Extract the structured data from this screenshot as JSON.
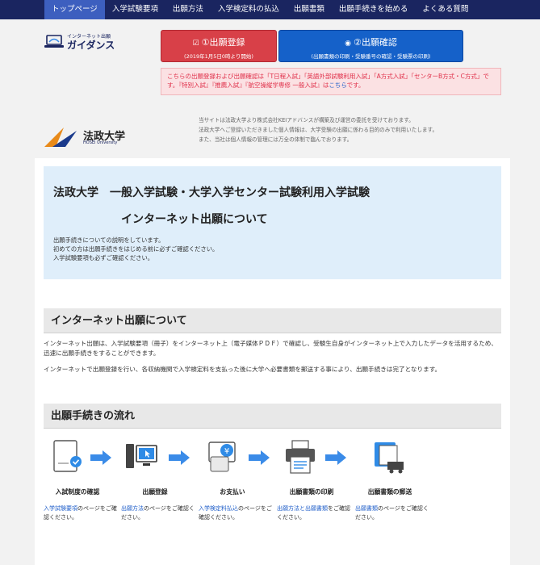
{
  "nav": {
    "items": [
      {
        "label": "トップページ"
      },
      {
        "label": "入学試験要項"
      },
      {
        "label": "出願方法"
      },
      {
        "label": "入学検定料の払込"
      },
      {
        "label": "出願書類"
      },
      {
        "label": "出願手続きを始める"
      },
      {
        "label": "よくある質問"
      }
    ]
  },
  "logo": {
    "small": "インターネット出願",
    "big": "ガイダンス"
  },
  "buttons": {
    "apply_title": "①出願登録",
    "apply_sub": "(2019年1月5日0時より開始)",
    "confirm_title": "②出願確認",
    "confirm_sub": "(出願書類の印刷・受験番号の確認・受験票の印刷)"
  },
  "notice": {
    "text": "こちらの出願登録および出願確認は「T日程入試」「英語外部試験利用入試」「A方式入試」「センターB方式・C方式」です。『特別入試』『推薦入試』『航空操縦学専修 一般入試』は",
    "link": "こちら",
    "tail": "です。"
  },
  "disclaimer": {
    "line1": "当サイトは法政大学より株式会社KEIアドバンスが構築及び運営の委託を受けております。",
    "line2": "法政大学へご登録いただきました個人情報は、大学受験の出願に係わる目的のみで利用いたします。",
    "line3": "また、当社は個人情報の管理には万全の体制で臨んでおります。"
  },
  "university": {
    "name_jp": "法政大学",
    "name_en": "HOSEI University"
  },
  "intro": {
    "title_line1": "法政大学　一般入学試験・大学入学センター試験利用入学試験",
    "title_line2": "インターネット出願について",
    "desc1": "出願手続きについての説明をしています。",
    "desc2": "初めての方は出願手続きをはじめる前に必ずご確認ください。",
    "desc3": "入学試験要項も必ずご確認ください。"
  },
  "section_about": {
    "heading": "インターネット出願について",
    "p1": "インターネット出願は、入学試験要項（冊子）をインターネット上（電子媒体ＰＤＦ）で確認し、受験生自身がインターネット上で入力したデータを活用するため、迅速に出願手続きをすることができます。",
    "p2": "インターネットで出願登録を行い、各収納機関で入学検定料を支払った後に大学へ必要書類を郵送する事により、出願手続きは完了となります。"
  },
  "section_flow": {
    "heading": "出願手続きの流れ",
    "steps": [
      {
        "title": "入試制度の確認",
        "link": "入学試験要項",
        "desc": "のページをご確認ください。"
      },
      {
        "title": "出願登録",
        "link": "出願方法",
        "desc": "のページをご確認ください。"
      },
      {
        "title": "お支払い",
        "link": "入学検定料払込",
        "desc": "のページをご確認ください。"
      },
      {
        "title": "出願書類の印刷",
        "link": "出願方法と出願書類",
        "desc": "をご確認ください。"
      },
      {
        "title": "出願書類の郵送",
        "link": "出願書類",
        "desc": "のページをご確認ください。"
      }
    ]
  },
  "colors": {
    "nav_bg": "#1a2560",
    "nav_active": "#3d5fbf",
    "apply_red": "#d84048",
    "confirm_blue": "#1561c9",
    "link": "#1f5ec9",
    "arrow": "#3a8be8"
  }
}
